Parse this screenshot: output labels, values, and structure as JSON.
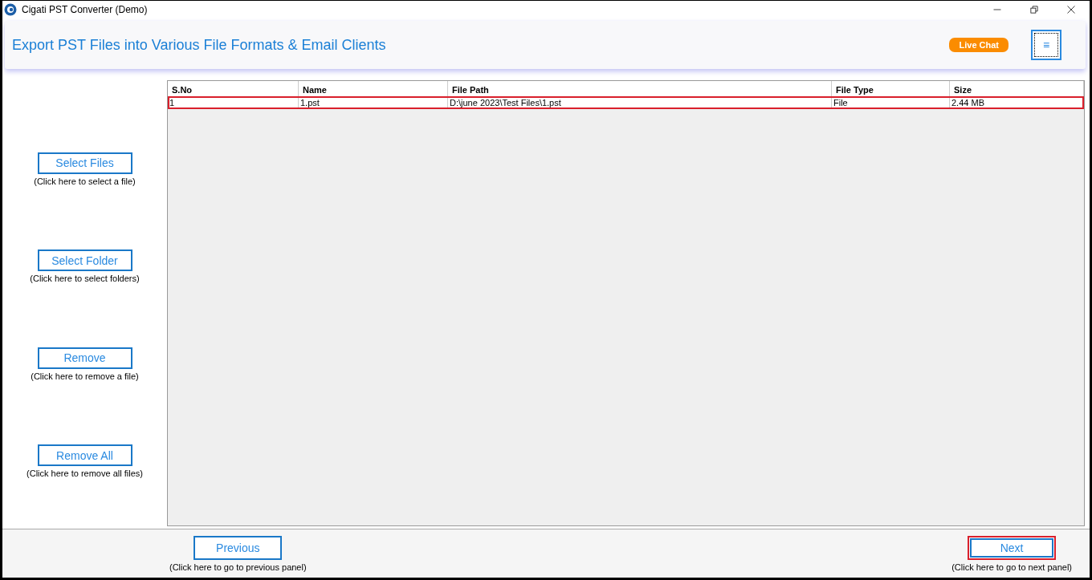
{
  "window": {
    "title": "Cigati PST Converter (Demo)"
  },
  "header": {
    "title": "Export PST Files into Various File Formats & Email Clients",
    "live_chat": "Live Chat",
    "menu_button": "≡"
  },
  "actions": [
    {
      "label": "Select Files",
      "hint": "(Click here to select a file)"
    },
    {
      "label": "Select Folder",
      "hint": "(Click here to select folders)"
    },
    {
      "label": "Remove",
      "hint": "(Click here to remove a file)"
    },
    {
      "label": "Remove All",
      "hint": "(Click here to remove all files)"
    }
  ],
  "table": {
    "columns": [
      "S.No",
      "Name",
      "File Path",
      "File Type",
      "Size"
    ],
    "rows": [
      {
        "cells": [
          "1",
          "1.pst",
          "D:\\june 2023\\Test Files\\1.pst",
          "File",
          "2.44 MB"
        ],
        "selected": true
      }
    ]
  },
  "footer": {
    "buttons": [
      {
        "label": "Previous",
        "hint": "(Click here to go to previous panel)",
        "highlighted": false
      },
      {
        "label": "Next",
        "hint": "(Click here to go to next panel)",
        "highlighted": true
      }
    ]
  }
}
